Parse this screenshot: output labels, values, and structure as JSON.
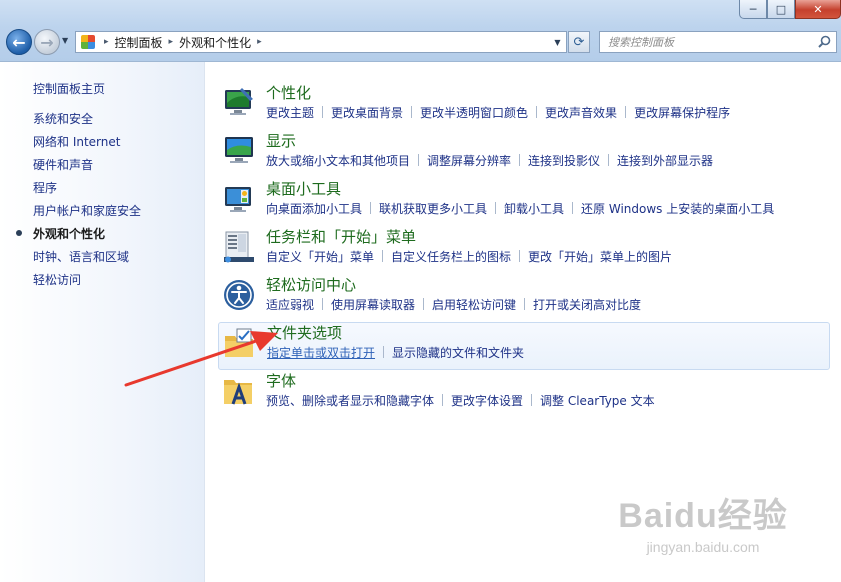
{
  "window": {
    "controls": [
      "─",
      "□",
      "✕"
    ]
  },
  "nav": {
    "back_glyph": "←",
    "forward_glyph": "→",
    "history_glyph": "▼"
  },
  "address": {
    "breadcrumbs": [
      "控制面板",
      "外观和个性化"
    ],
    "separator": "▸",
    "dropdown_glyph": "▼"
  },
  "refresh_glyph": "⟳",
  "search": {
    "placeholder": "搜索控制面板",
    "icon": "search-icon"
  },
  "sidebar": {
    "home": "控制面板主页",
    "items": [
      {
        "label": "系统和安全",
        "active": false
      },
      {
        "label": "网络和 Internet",
        "active": false
      },
      {
        "label": "硬件和声音",
        "active": false
      },
      {
        "label": "程序",
        "active": false
      },
      {
        "label": "用户帐户和家庭安全",
        "active": false
      },
      {
        "label": "外观和个性化",
        "active": true
      },
      {
        "label": "时钟、语言和区域",
        "active": false
      },
      {
        "label": "轻松访问",
        "active": false
      }
    ]
  },
  "categories": [
    {
      "title": "个性化",
      "icon": "personalization-icon",
      "links": [
        "更改主题",
        "更改桌面背景",
        "更改半透明窗口颜色",
        "更改声音效果",
        "更改屏幕保护程序"
      ]
    },
    {
      "title": "显示",
      "icon": "display-icon",
      "links": [
        "放大或缩小文本和其他项目",
        "调整屏幕分辨率",
        "连接到投影仪",
        "连接到外部显示器"
      ]
    },
    {
      "title": "桌面小工具",
      "icon": "gadgets-icon",
      "links": [
        "向桌面添加小工具",
        "联机获取更多小工具",
        "卸载小工具",
        "还原 Windows 上安装的桌面小工具"
      ]
    },
    {
      "title": "任务栏和「开始」菜单",
      "icon": "taskbar-icon",
      "links": [
        "自定义「开始」菜单",
        "自定义任务栏上的图标",
        "更改「开始」菜单上的图片"
      ]
    },
    {
      "title": "轻松访问中心",
      "icon": "ease-of-access-icon",
      "links": [
        "适应弱视",
        "使用屏幕读取器",
        "启用轻松访问键",
        "打开或关闭高对比度"
      ]
    },
    {
      "title": "文件夹选项",
      "icon": "folder-options-icon",
      "links": [
        "指定单击或双击打开",
        "显示隐藏的文件和文件夹"
      ],
      "highlighted": true
    },
    {
      "title": "字体",
      "icon": "fonts-icon",
      "links": [
        "预览、删除或者显示和隐藏字体",
        "更改字体设置",
        "调整 ClearType 文本"
      ]
    }
  ],
  "watermark": {
    "brand": "Baidu经验",
    "sub": "jingyan.baidu.com"
  },
  "colors": {
    "link": "#1e3287",
    "category_title": "#1e6b1e",
    "arrow": "#e8392e"
  }
}
